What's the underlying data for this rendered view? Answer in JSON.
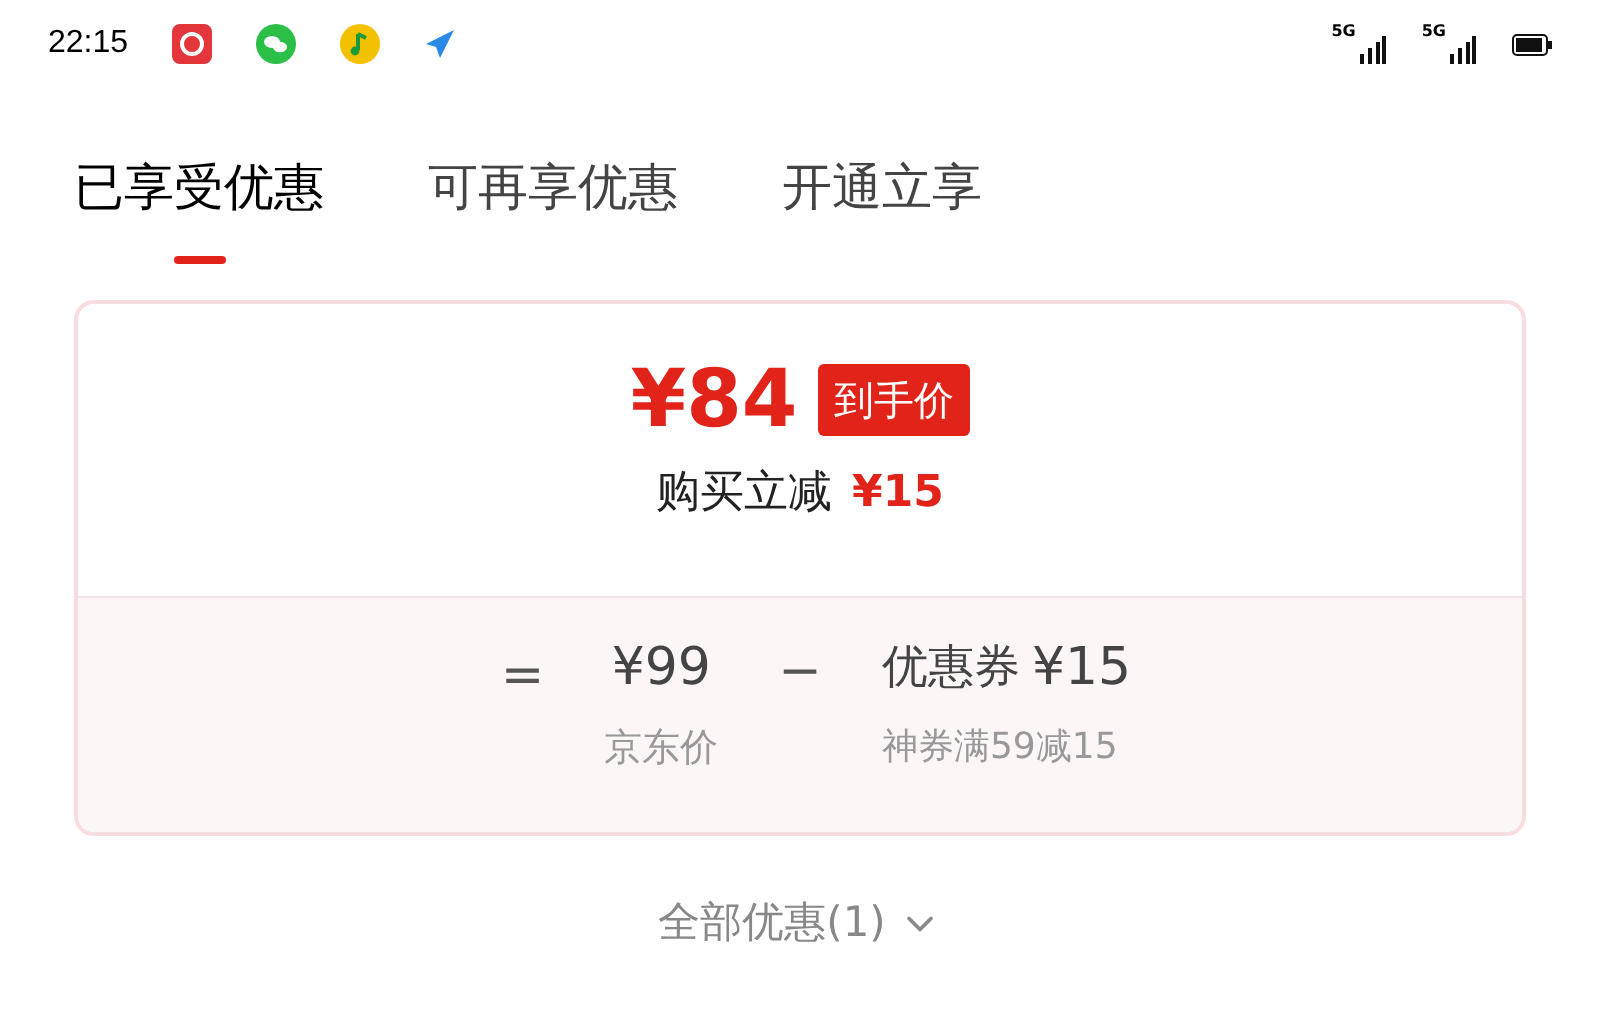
{
  "status_bar": {
    "time": "22:15",
    "signals": [
      {
        "label": "5G"
      },
      {
        "label": "5G"
      }
    ]
  },
  "tabs": [
    {
      "label": "已享受优惠",
      "selected": true
    },
    {
      "label": "可再享优惠",
      "selected": false
    },
    {
      "label": "开通立享"
    }
  ],
  "summary": {
    "price": "¥84",
    "badge": "到手价",
    "discount_label": "购买立减",
    "discount_value": "¥15"
  },
  "breakdown": {
    "equals": "=",
    "original_price": "¥99",
    "original_label": "京东价",
    "minus": "−",
    "coupon_label": "优惠券",
    "coupon_value": "¥15",
    "coupon_note": "神券满59减15"
  },
  "footer": {
    "label": "全部优惠(1)"
  }
}
